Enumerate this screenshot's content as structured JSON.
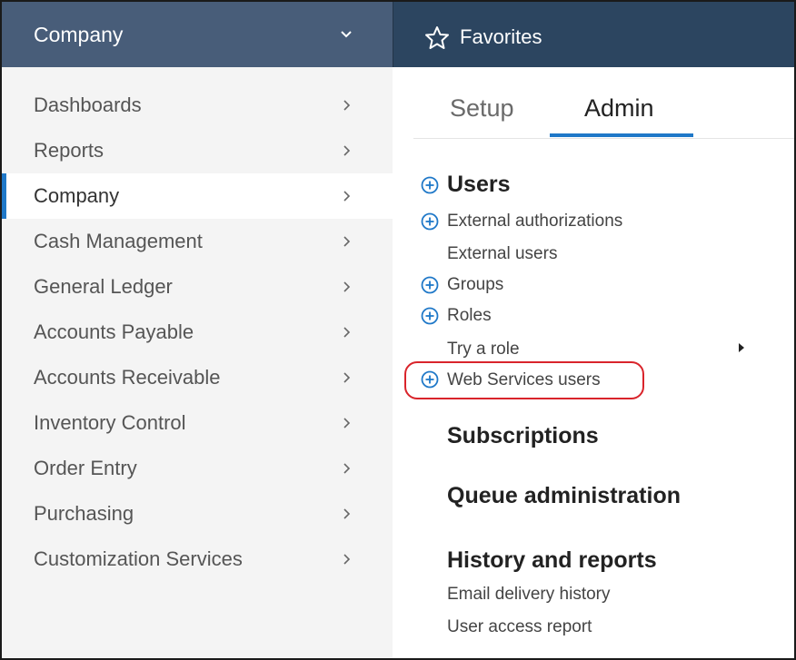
{
  "header": {
    "module_title": "Company",
    "favorites_label": "Favorites"
  },
  "sidebar": {
    "items": [
      {
        "label": "Dashboards",
        "active": false
      },
      {
        "label": "Reports",
        "active": false
      },
      {
        "label": "Company",
        "active": true
      },
      {
        "label": "Cash Management",
        "active": false
      },
      {
        "label": "General Ledger",
        "active": false
      },
      {
        "label": "Accounts Payable",
        "active": false
      },
      {
        "label": "Accounts Receivable",
        "active": false
      },
      {
        "label": "Inventory Control",
        "active": false
      },
      {
        "label": "Order Entry",
        "active": false
      },
      {
        "label": "Purchasing",
        "active": false
      },
      {
        "label": "Customization Services",
        "active": false
      }
    ]
  },
  "tabs": {
    "setup": "Setup",
    "admin": "Admin",
    "selected": "Admin"
  },
  "admin": {
    "users_heading": "Users",
    "external_authorizations": "External authorizations",
    "external_users": "External users",
    "groups": "Groups",
    "roles": "Roles",
    "try_a_role": "Try a role",
    "web_services_users": "Web Services users",
    "subscriptions": "Subscriptions",
    "queue_administration": "Queue administration",
    "history_and_reports": "History and reports",
    "email_delivery_history": "Email delivery history",
    "user_access_report": "User access report"
  },
  "colors": {
    "header_left": "#485d79",
    "header_right": "#2c4560",
    "accent": "#1f78c8",
    "highlight": "#d9242b"
  }
}
